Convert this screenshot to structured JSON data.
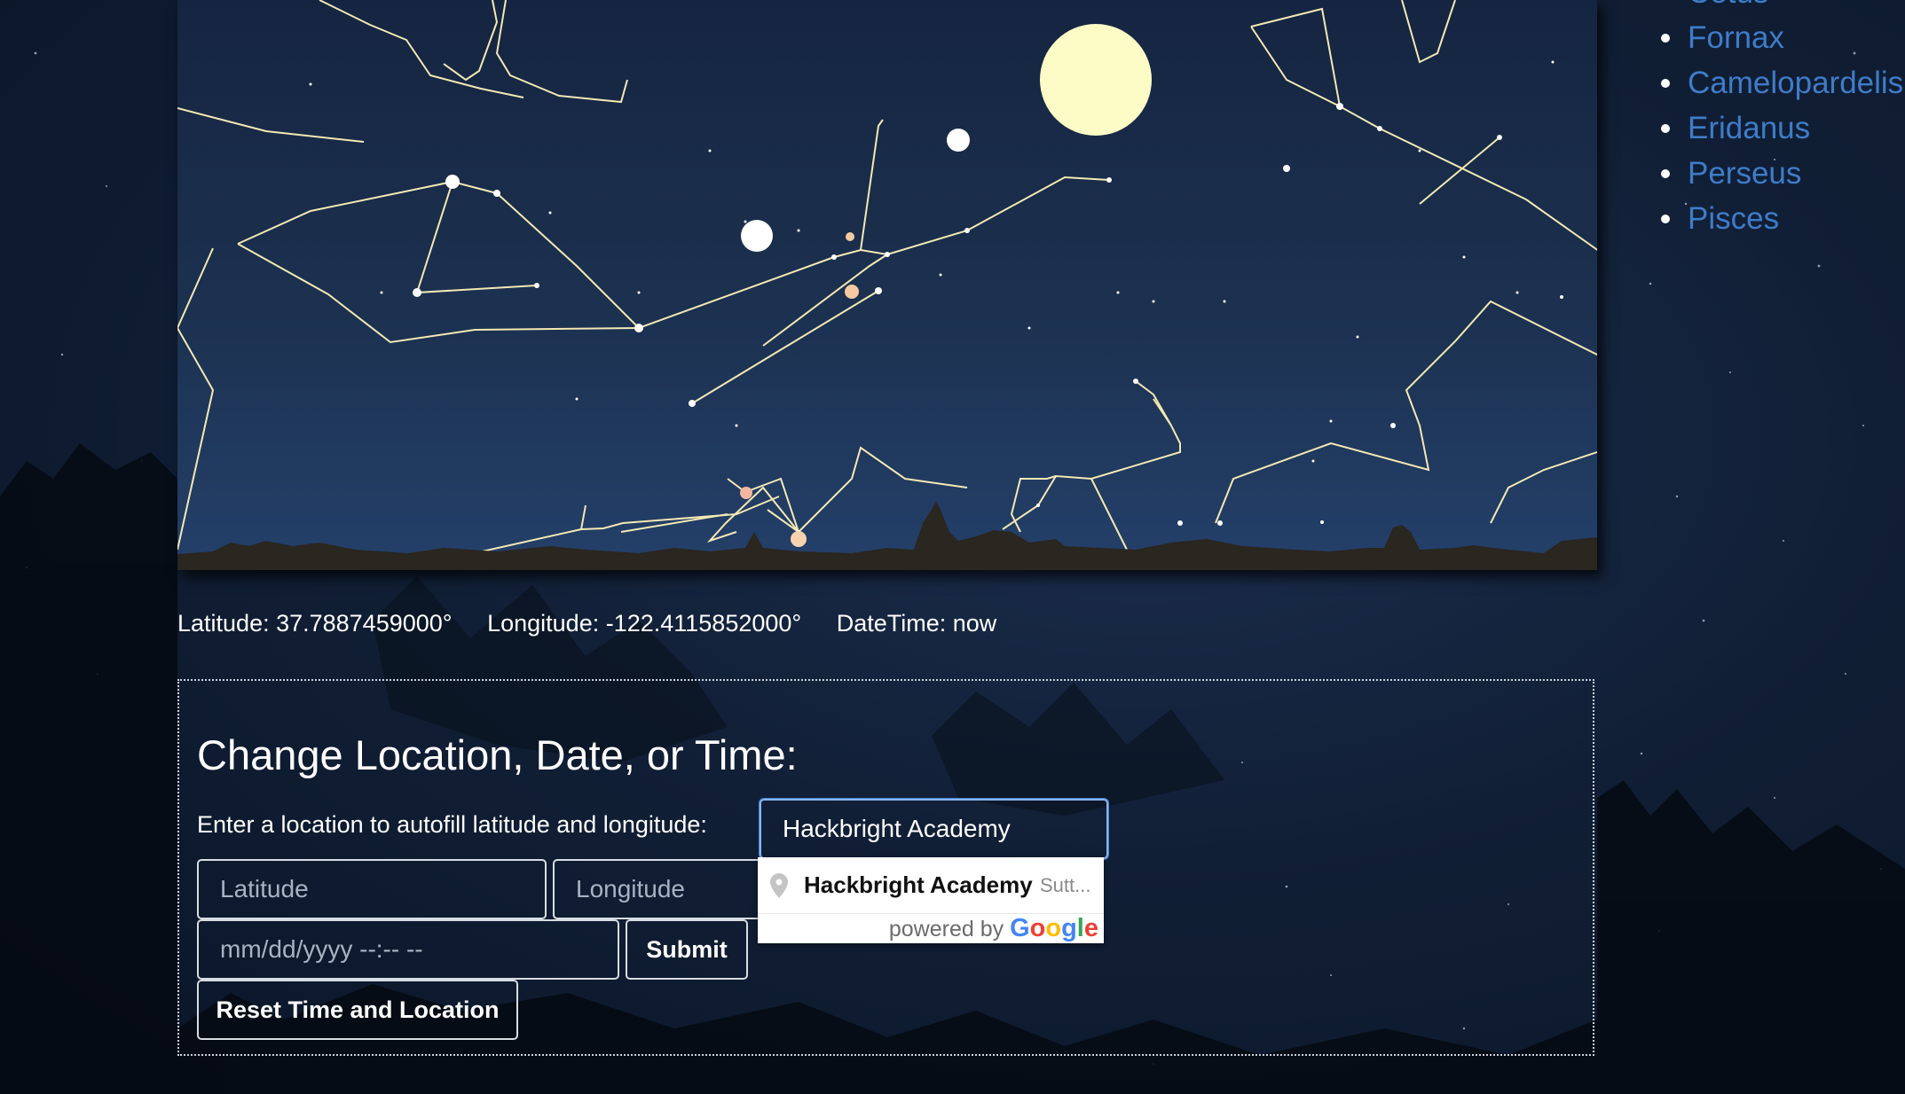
{
  "constellations": {
    "partial_top": "Cetus",
    "items": [
      "Fornax",
      "Camelopardelis",
      "Eridanus",
      "Perseus",
      "Pisces"
    ]
  },
  "coords": {
    "latitude": "Latitude: 37.7887459000°",
    "longitude": "Longitude: -122.4115852000°",
    "datetime": "DateTime: now"
  },
  "form": {
    "title": "Change Location, Date, or Time:",
    "location_label": "Enter a location to autofill latitude and longitude:",
    "location_value": "Hackbright Academy",
    "latitude_placeholder": "Latitude",
    "longitude_placeholder": "Longitude",
    "datetime_placeholder": "mm/dd/yyyy --:-- --",
    "submit_label": "Submit",
    "reset_label": "Reset Time and Location"
  },
  "autocomplete": {
    "main_text": "Hackbright Academy",
    "secondary_text": "Sutt...",
    "powered_by": "powered by",
    "google": "Google"
  },
  "colors": {
    "link": "#3f7cc8",
    "constellation_line": "#f3e9b4",
    "moon": "#fdfbc6"
  },
  "icons": {
    "pin": "map-pin-icon"
  }
}
